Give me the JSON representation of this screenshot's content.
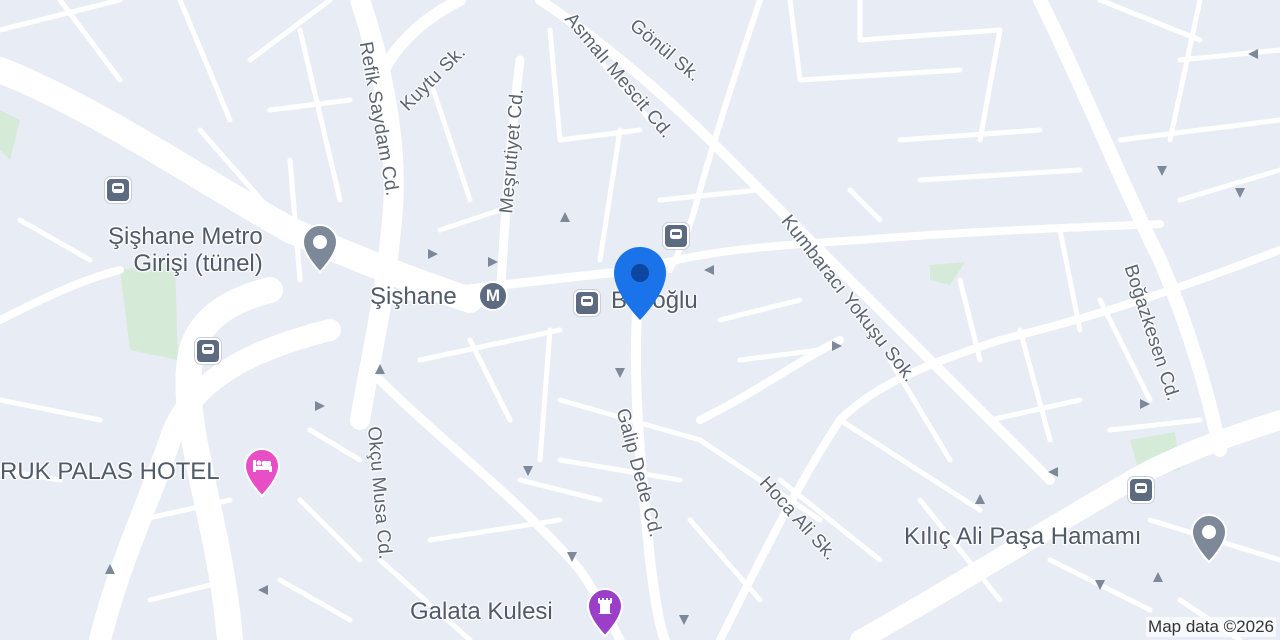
{
  "map": {
    "streets": [
      {
        "id": "refik-saydam",
        "name": "Refik Saydam Cd."
      },
      {
        "id": "kuytu",
        "name": "Kuytu Sk."
      },
      {
        "id": "mesrutiyet",
        "name": "Meşrutiyet Cd."
      },
      {
        "id": "asmali-mescit",
        "name": "Asmalı Mescit Cd."
      },
      {
        "id": "gonul",
        "name": "Gönül Sk."
      },
      {
        "id": "kumbaraci",
        "name": "Kumbaracı Yokuşu Sok."
      },
      {
        "id": "bogazkesen",
        "name": "Boğazkesen Cd."
      },
      {
        "id": "galip-dede",
        "name": "Galip Dede Cd."
      },
      {
        "id": "okcu-musa",
        "name": "Okçu Musa Cd."
      },
      {
        "id": "hoca-ali",
        "name": "Hoca Ali Sk."
      }
    ],
    "places": {
      "sishane_metro_girisi": "Şişhane Metro\nGirişi (tünel)",
      "sishane": "Şişhane",
      "sishane_badge": "M",
      "beyoglu": "Beyoğlu",
      "hotel": "RUK PALAS HOTEL",
      "kilic_ali": "Kılıç Ali Paşa Hamamı",
      "galata": "Galata Kulesi"
    },
    "attribution": "Map data ©2026",
    "colors": {
      "background": "#e8ecf5",
      "road": "#ffffff",
      "park": "#d6ead8",
      "pin": "#1a73e8",
      "hotel_pin": "#e84fc6",
      "tower_pin": "#9b3fc9",
      "poi_pin": "#7d8898"
    }
  }
}
